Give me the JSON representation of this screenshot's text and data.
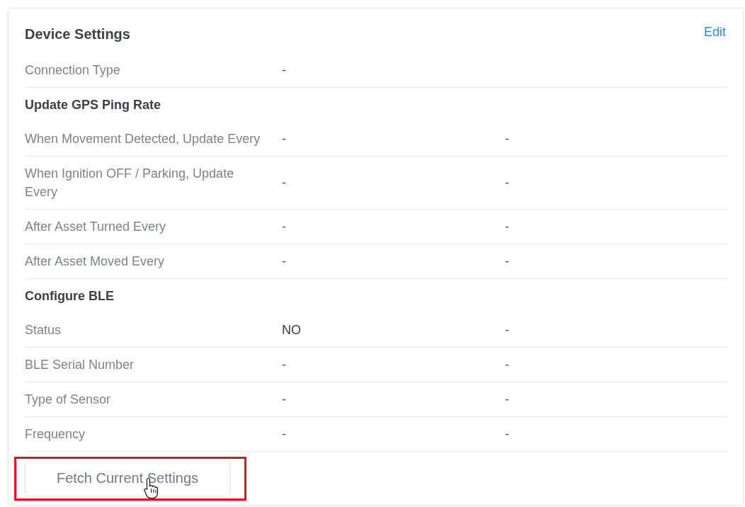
{
  "card": {
    "title": "Device Settings",
    "edit_link": "Edit"
  },
  "rows": [
    {
      "kind": "field",
      "label": "Connection Type",
      "values": [
        "-"
      ]
    },
    {
      "kind": "heading",
      "label": "Update GPS Ping Rate"
    },
    {
      "kind": "field",
      "label": "When Movement Detected, Update Every",
      "values": [
        "-",
        "-"
      ]
    },
    {
      "kind": "field",
      "label": "When Ignition OFF / Parking, Update Every",
      "values": [
        "-",
        "-"
      ]
    },
    {
      "kind": "field",
      "label": "After Asset Turned Every",
      "values": [
        "-",
        "-"
      ]
    },
    {
      "kind": "field",
      "label": "After Asset Moved Every",
      "values": [
        "-",
        "-"
      ]
    },
    {
      "kind": "heading",
      "label": "Configure BLE"
    },
    {
      "kind": "field",
      "label": "Status",
      "values": [
        "NO",
        "-"
      ]
    },
    {
      "kind": "field",
      "label": "BLE Serial Number",
      "values": [
        "-",
        "-"
      ]
    },
    {
      "kind": "field",
      "label": "Type of Sensor",
      "values": [
        "-",
        "-"
      ]
    },
    {
      "kind": "field",
      "label": "Frequency",
      "values": [
        "-",
        "-"
      ]
    }
  ],
  "fetch_button": {
    "label": "Fetch Current Settings",
    "highlighted": true,
    "hovered": true
  }
}
